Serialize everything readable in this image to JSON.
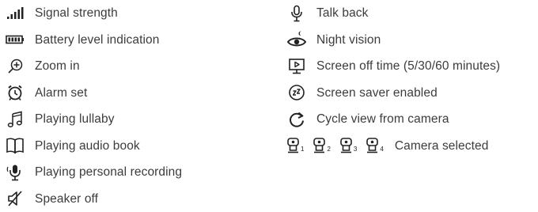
{
  "legend_left": [
    {
      "icon": "signal-strength-icon",
      "label": "Signal strength"
    },
    {
      "icon": "battery-icon",
      "label": "Battery level indication"
    },
    {
      "icon": "zoom-in-icon",
      "label": "Zoom in"
    },
    {
      "icon": "alarm-clock-icon",
      "label": "Alarm set"
    },
    {
      "icon": "music-note-icon",
      "label": "Playing lullaby"
    },
    {
      "icon": "open-book-icon",
      "label": "Playing audio book"
    },
    {
      "icon": "recording-microphone-icon",
      "label": "Playing personal recording"
    },
    {
      "icon": "speaker-off-icon",
      "label": "Speaker off"
    }
  ],
  "legend_right": [
    {
      "icon": "microphone-icon",
      "label": "Talk back"
    },
    {
      "icon": "night-vision-eye-icon",
      "label": "Night vision"
    },
    {
      "icon": "screen-off-timer-icon",
      "label": "Screen off time (5/30/60 minutes)"
    },
    {
      "icon": "screen-saver-icon",
      "label": "Screen saver enabled"
    },
    {
      "icon": "cycle-view-icon",
      "label": "Cycle view from camera"
    },
    {
      "icon": "camera-selected-icon",
      "label": "Camera selected",
      "camera_numbers": [
        "1",
        "2",
        "3",
        "4"
      ]
    }
  ]
}
